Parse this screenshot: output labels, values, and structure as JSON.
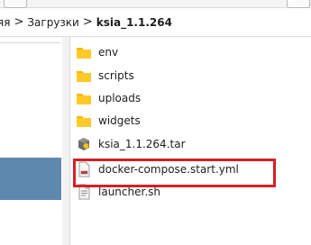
{
  "breadcrumb": {
    "items": [
      "яя",
      "Загрузки",
      "ksia_1.1.264"
    ],
    "separator": ">"
  },
  "files": [
    {
      "name": "env",
      "type": "folder",
      "icon": "folder-icon"
    },
    {
      "name": "scripts",
      "type": "folder",
      "icon": "folder-icon"
    },
    {
      "name": "uploads",
      "type": "folder",
      "icon": "folder-icon"
    },
    {
      "name": "widgets",
      "type": "folder",
      "icon": "folder-icon"
    },
    {
      "name": "ksia_1.1.264.tar",
      "type": "archive",
      "icon": "archive-icon"
    },
    {
      "name": "docker-compose.start.yml",
      "type": "yaml",
      "icon": "yaml-file-icon",
      "highlighted": true
    },
    {
      "name": "launcher.sh",
      "type": "script",
      "icon": "script-file-icon"
    }
  ],
  "colors": {
    "highlight": "#d42127",
    "folder": "#f6b500",
    "sidebar_selection": "#5e88ad"
  }
}
